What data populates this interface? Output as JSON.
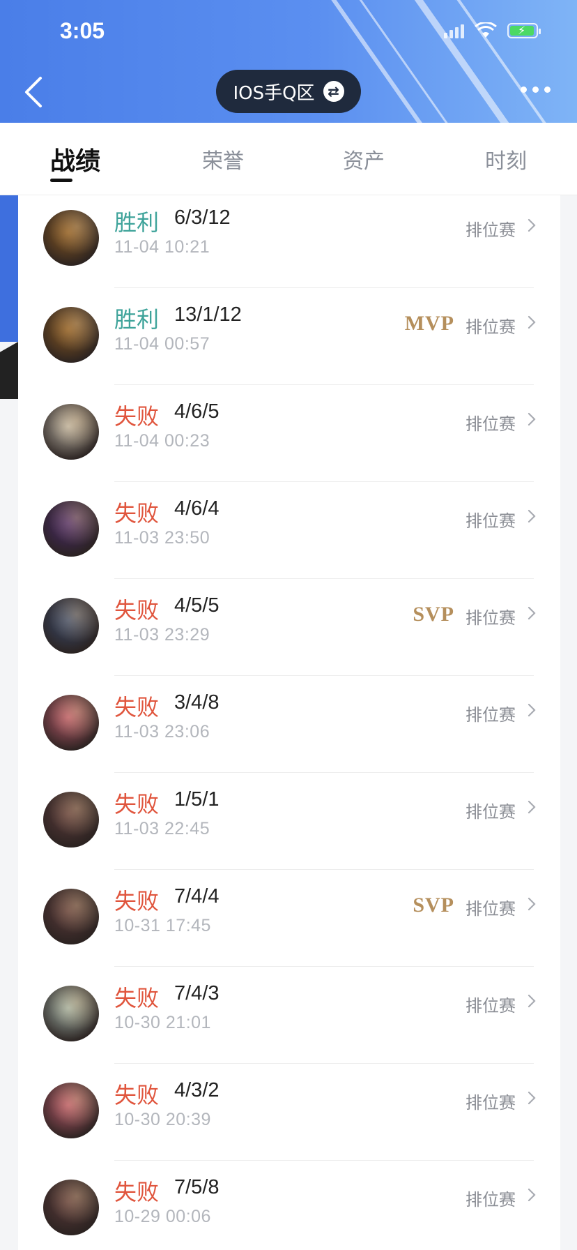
{
  "status_bar": {
    "time": "3:05"
  },
  "header": {
    "region": "IOS手Q区"
  },
  "tabs": [
    {
      "label": "战绩",
      "active": true
    },
    {
      "label": "荣誉",
      "active": false
    },
    {
      "label": "资产",
      "active": false
    },
    {
      "label": "时刻",
      "active": false
    }
  ],
  "matches": [
    {
      "result": "胜利",
      "outcome": "win",
      "kda": "6/3/12",
      "time": "11-04 10:21",
      "badge": "",
      "mode": "排位赛",
      "avatar_color": "#8a5a22"
    },
    {
      "result": "胜利",
      "outcome": "win",
      "kda": "13/1/12",
      "time": "11-04 00:57",
      "badge": "MVP",
      "mode": "排位赛",
      "avatar_color": "#8a5a22"
    },
    {
      "result": "失败",
      "outcome": "loss",
      "kda": "4/6/5",
      "time": "11-04 00:23",
      "badge": "",
      "mode": "排位赛",
      "avatar_color": "#b9b2a4"
    },
    {
      "result": "失败",
      "outcome": "loss",
      "kda": "4/6/4",
      "time": "11-03 23:50",
      "badge": "",
      "mode": "排位赛",
      "avatar_color": "#4a2a6a"
    },
    {
      "result": "失败",
      "outcome": "loss",
      "kda": "4/5/5",
      "time": "11-03 23:29",
      "badge": "SVP",
      "mode": "排位赛",
      "avatar_color": "#3a4a6a"
    },
    {
      "result": "失败",
      "outcome": "loss",
      "kda": "3/4/8",
      "time": "11-03 23:06",
      "badge": "",
      "mode": "排位赛",
      "avatar_color": "#b8596a"
    },
    {
      "result": "失败",
      "outcome": "loss",
      "kda": "1/5/1",
      "time": "11-03 22:45",
      "badge": "",
      "mode": "排位赛",
      "avatar_color": "#5a3a3a"
    },
    {
      "result": "失败",
      "outcome": "loss",
      "kda": "7/4/4",
      "time": "10-31 17:45",
      "badge": "SVP",
      "mode": "排位赛",
      "avatar_color": "#5a3a3a"
    },
    {
      "result": "失败",
      "outcome": "loss",
      "kda": "7/4/3",
      "time": "10-30 21:01",
      "badge": "",
      "mode": "排位赛",
      "avatar_color": "#9fb0a6"
    },
    {
      "result": "失败",
      "outcome": "loss",
      "kda": "4/3/2",
      "time": "10-30 20:39",
      "badge": "",
      "mode": "排位赛",
      "avatar_color": "#b8596a"
    },
    {
      "result": "失败",
      "outcome": "loss",
      "kda": "7/5/8",
      "time": "10-29 00:06",
      "badge": "",
      "mode": "排位赛",
      "avatar_color": "#5a3a3a"
    }
  ]
}
